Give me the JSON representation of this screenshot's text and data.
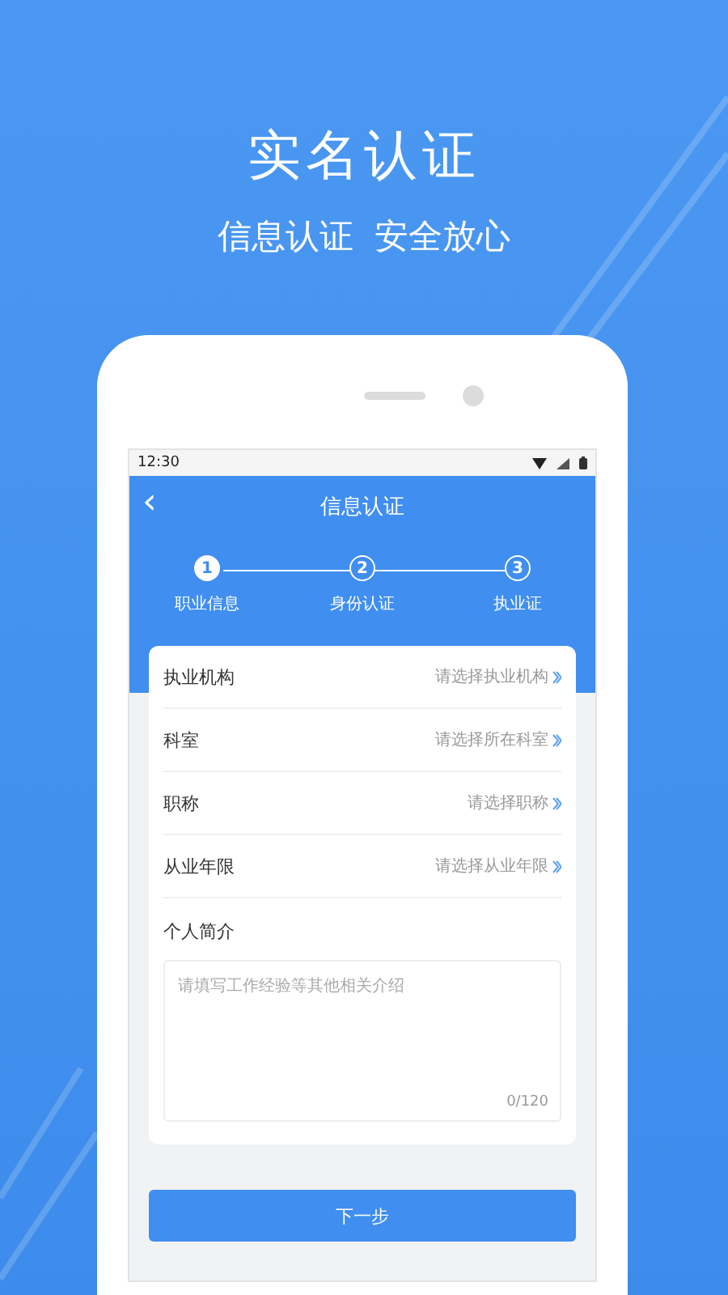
{
  "headline": "实名认证",
  "tagline": "信息认证  安全放心",
  "status_bar": {
    "time": "12:30"
  },
  "nav": {
    "back": "‹",
    "title": "信息认证"
  },
  "steps": [
    {
      "number": "1",
      "label": "职业信息",
      "selected": true
    },
    {
      "number": "2",
      "label": "身份认证",
      "selected": false
    },
    {
      "number": "3",
      "label": "执业证",
      "selected": false
    }
  ],
  "form": {
    "fields": [
      {
        "label": "执业机构",
        "placeholder": "请选择执业机构"
      },
      {
        "label": "科室",
        "placeholder": "请选择所在科室"
      },
      {
        "label": "职称",
        "placeholder": "请选择职称"
      },
      {
        "label": "从业年限",
        "placeholder": "请选择从业年限"
      }
    ],
    "intro": {
      "label": "个人简介",
      "placeholder": "请填写工作经验等其他相关介绍",
      "counter": "0/120"
    }
  },
  "next_button": "下一步"
}
